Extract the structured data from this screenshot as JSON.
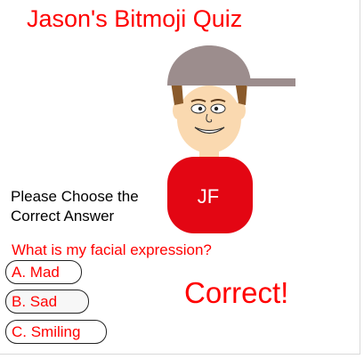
{
  "quiz": {
    "title": "Jason's Bitmoji Quiz",
    "prompt_line1": "Please Choose the",
    "prompt_line2": "Correct Answer",
    "question": "What is my facial expression?",
    "options": [
      {
        "label": "A. Mad"
      },
      {
        "label": "B. Sad"
      },
      {
        "label": "C. Smiling"
      }
    ],
    "feedback": "Correct!"
  },
  "avatar": {
    "shirt_initials": "JF"
  },
  "colors": {
    "accent": "#ff0000",
    "cap": "#9c8d8d",
    "hair": "#8a5a2b",
    "skin": "#fad9b0",
    "shirt": "#e30613",
    "text": "#000000"
  }
}
